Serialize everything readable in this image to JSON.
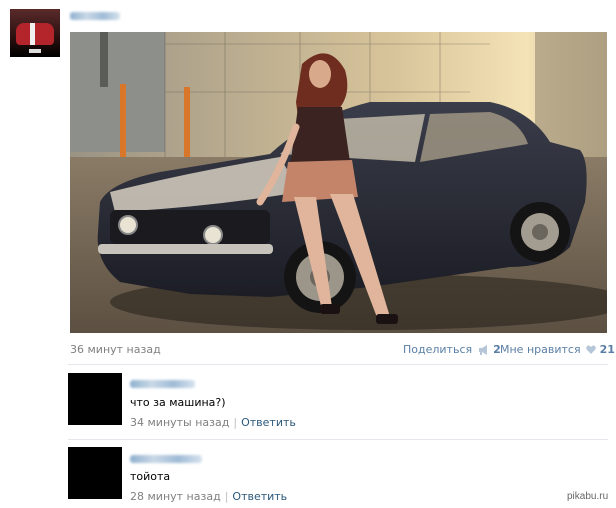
{
  "post": {
    "time": "36 минут назад",
    "share_label": "Поделиться",
    "share_count": "2",
    "like_label": "Мне нравится",
    "like_count": "21"
  },
  "comments": [
    {
      "text": "что за машина?)",
      "time": "34 минуты назад",
      "reply_label": "Ответить"
    },
    {
      "text": "тойота",
      "time": "28 минут назад",
      "reply_label": "Ответить"
    }
  ],
  "watermark": "pikabu.ru",
  "colors": {
    "link": "#2b587a",
    "meta": "#808080",
    "action": "#5b7fa6",
    "divider": "#e4e8ed"
  },
  "icons": {
    "share": "megaphone-icon",
    "like": "heart-icon"
  }
}
